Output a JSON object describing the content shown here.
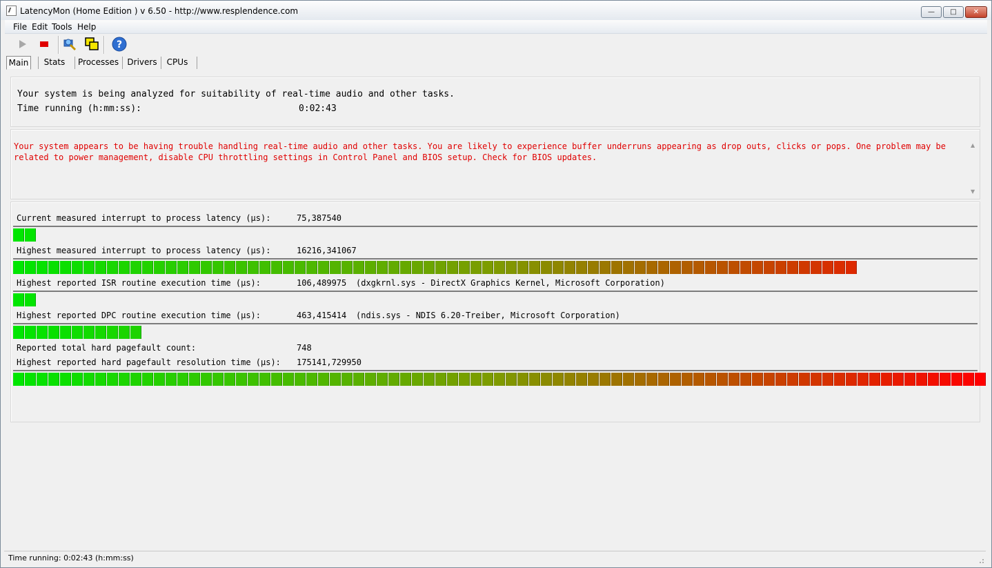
{
  "window": {
    "title": "LatencyMon  (Home Edition )  v 6.50 - http://www.resplendence.com",
    "minimize_glyph": "—",
    "maximize_glyph": "□",
    "close_glyph": "✕"
  },
  "menu": {
    "file": "File",
    "edit": "Edit",
    "tools": "Tools",
    "help": "Help"
  },
  "toolbar": {
    "start_icon": "play-icon",
    "stop_icon": "stop-icon",
    "search_icon": "search-driver-icon",
    "window_icon": "windows-icon",
    "help_icon": "help-icon",
    "help_glyph": "?"
  },
  "tabs": {
    "main": "Main",
    "stats": "Stats",
    "processes": "Processes",
    "drivers": "Drivers",
    "cpus": "CPUs"
  },
  "summary": {
    "line1": "Your system is being analyzed for suitability of real-time audio and other tasks.",
    "time_label": "Time running (h:mm:ss):",
    "time_value": "0:02:43"
  },
  "warning": {
    "text": "Your system appears to be having trouble handling real-time audio and other tasks. You are likely to experience buffer underruns appearing as drop outs, clicks or pops. One problem may be related to power management, disable CPU throttling settings in Control Panel and BIOS setup. Check for BIOS updates.",
    "color": "#e00000"
  },
  "metrics": {
    "current_latency": {
      "label": "Current measured interrupt to process latency (µs):",
      "value": "75,387540",
      "segments": 2
    },
    "highest_latency": {
      "label": "Highest measured interrupt to process latency (µs):",
      "value": "16216,341067",
      "segments": 72
    },
    "isr": {
      "label": "Highest reported ISR routine execution time (µs):",
      "value": "106,489975",
      "driver": "(dxgkrnl.sys - DirectX Graphics Kernel, Microsoft Corporation)",
      "segments": 2
    },
    "dpc": {
      "label": "Highest reported DPC routine execution time (µs):",
      "value": "463,415414",
      "driver": "(ndis.sys - NDIS 6.20-Treiber, Microsoft Corporation)",
      "segments": 11
    },
    "pagefault_count": {
      "label": "Reported total hard pagefault count:",
      "value": "748"
    },
    "pagefault_time": {
      "label": "Highest reported hard pagefault resolution time (µs):",
      "value": "175141,729950",
      "segments": 83
    }
  },
  "colors": {
    "bar_start": "#00e600",
    "bar_mid": "#7f9a00",
    "bar_end": "#ff0000"
  },
  "statusbar": {
    "text": "Time running: 0:02:43  (h:mm:ss)"
  }
}
